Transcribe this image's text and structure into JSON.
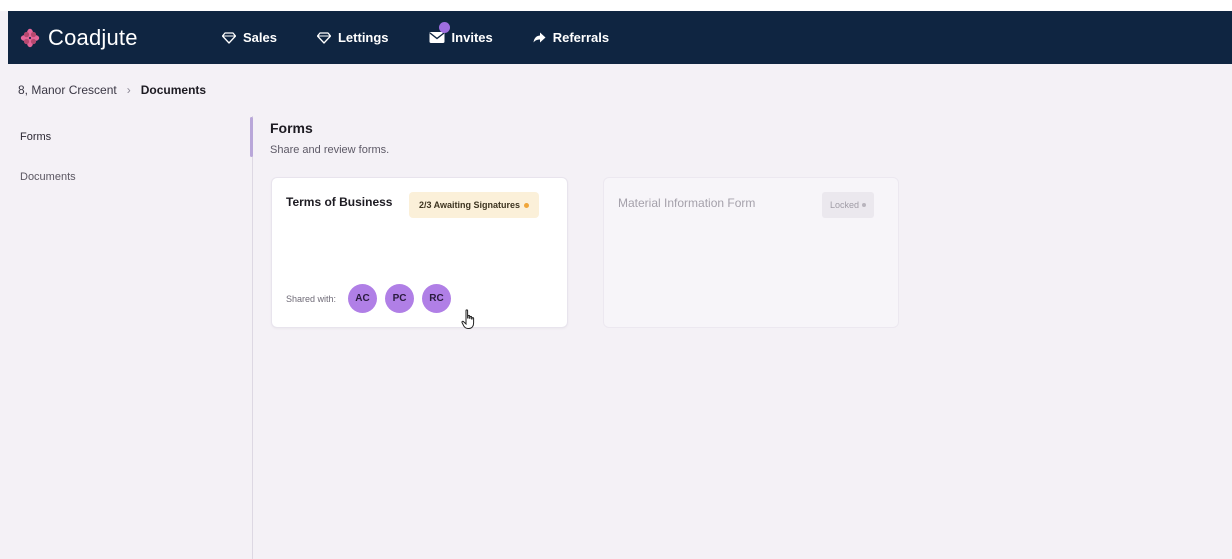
{
  "app": {
    "name": "Coadjute",
    "brand_color": "#0f2541",
    "accent_color": "#b07fe6"
  },
  "nav": {
    "items": [
      {
        "label": "Sales",
        "icon": "gem-icon"
      },
      {
        "label": "Lettings",
        "icon": "gem-icon"
      },
      {
        "label": "Invites",
        "icon": "envelope-icon",
        "has_notification": true
      },
      {
        "label": "Referrals",
        "icon": "arrow-forward-icon"
      }
    ]
  },
  "breadcrumb": {
    "parent": "8, Manor Crescent",
    "current": "Documents"
  },
  "sidebar": {
    "items": [
      {
        "label": "Forms",
        "active": true
      },
      {
        "label": "Documents",
        "active": false
      }
    ]
  },
  "main": {
    "title": "Forms",
    "subtitle": "Share and review forms."
  },
  "cards": [
    {
      "title": "Terms of Business",
      "status": "2/3 Awaiting Signatures",
      "status_color": "#fbf0d9",
      "shared_label": "Shared with:",
      "avatars": [
        "AC",
        "PC",
        "RC"
      ]
    },
    {
      "title": "Material Information Form",
      "status": "Locked",
      "locked": true
    }
  ]
}
